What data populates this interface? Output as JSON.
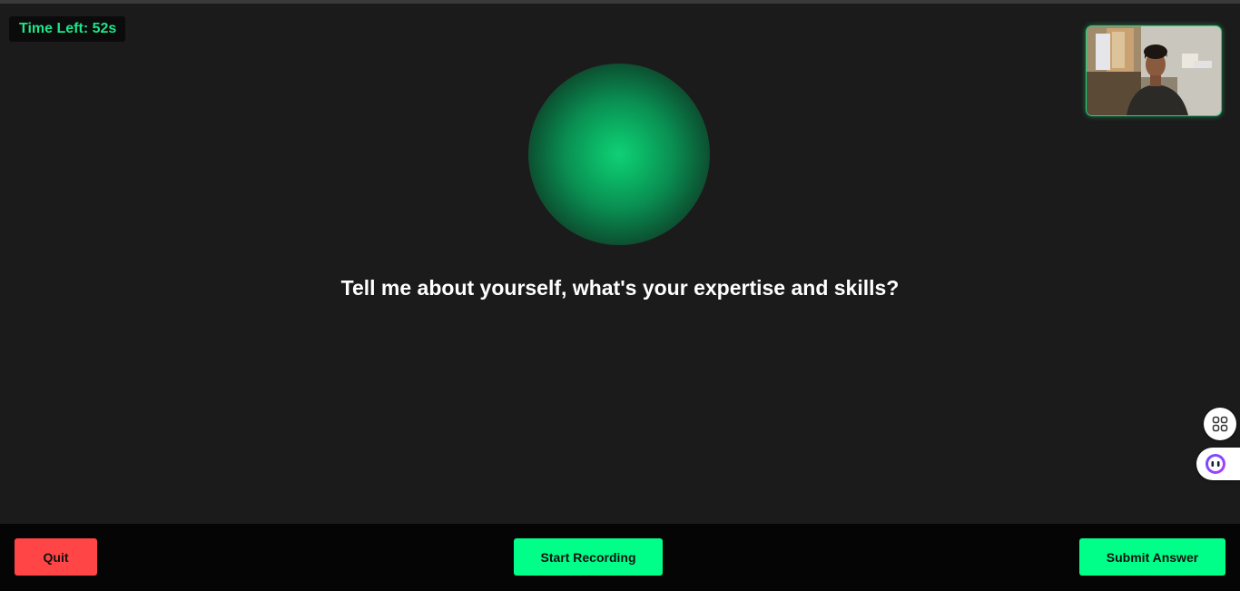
{
  "timer": {
    "label": "Time Left: 52s"
  },
  "question": {
    "text": "Tell me about yourself, what's your expertise and skills?"
  },
  "camera": {
    "icon": "webcam-preview"
  },
  "side_widgets": {
    "apps_icon": "apps-grid-icon",
    "assistant_icon": "assistant-face-icon"
  },
  "footer": {
    "quit_label": "Quit",
    "record_label": "Start Recording",
    "submit_label": "Submit Answer"
  },
  "colors": {
    "accent_green": "#00ff88",
    "danger_red": "#ff4545",
    "timer_green": "#1ee58a",
    "background": "#1b1b1b",
    "footer_background": "#050505"
  }
}
